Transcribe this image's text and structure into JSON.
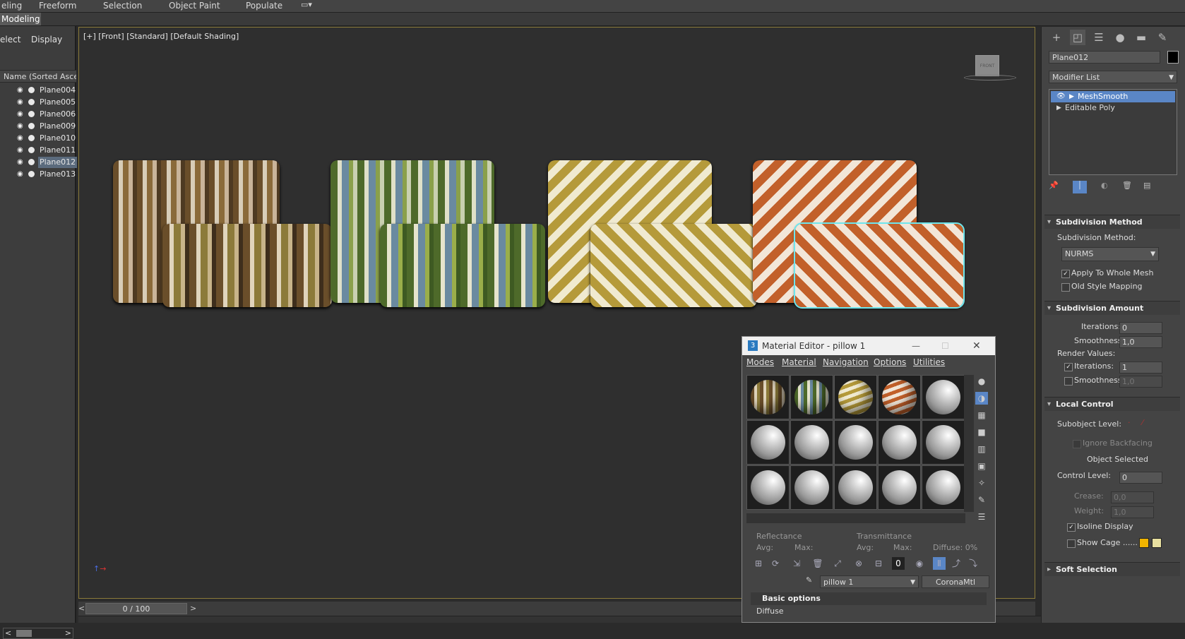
{
  "ribbon": {
    "tabs": [
      "eling",
      "Freeform",
      "Selection",
      "Object Paint",
      "Populate"
    ]
  },
  "modebar": {
    "label": "Modeling"
  },
  "explorer": {
    "tab_select": "elect",
    "tab_display": "Display",
    "column_header": "Name (Sorted Ascen",
    "items": [
      "Plane004",
      "Plane005",
      "Plane006",
      "Plane009",
      "Plane010",
      "Plane011",
      "Plane012",
      "Plane013"
    ],
    "selected": "Plane012"
  },
  "viewport": {
    "label": "[+] [Front] [Standard] [Default Shading]",
    "viewcube_label": "FRONT"
  },
  "timeline": {
    "frame": "0 / 100",
    "prev": "<",
    "next": ">"
  },
  "command_panel": {
    "object_name": "Plane012",
    "modifier_list_label": "Modifier List",
    "stack": [
      "MeshSmooth",
      "Editable Poly"
    ],
    "subdivision_method": {
      "header": "Subdivision Method",
      "label": "Subdivision Method:",
      "value": "NURMS",
      "apply_whole_mesh": "Apply To Whole Mesh",
      "old_style_mapping": "Old Style Mapping"
    },
    "subdivision_amount": {
      "header": "Subdivision Amount",
      "iterations_label": "Iterations:",
      "iterations": "0",
      "smoothness_label": "Smoothness:",
      "smoothness": "1,0",
      "render_values": "Render Values:",
      "render_iterations_label": "Iterations:",
      "render_iterations": "1",
      "render_smoothness_label": "Smoothness:",
      "render_smoothness": "1,0"
    },
    "local_control": {
      "header": "Local Control",
      "subobject_label": "Subobject Level:",
      "ignore_backfacing": "Ignore Backfacing",
      "object_selected": "Object Selected",
      "control_level_label": "Control Level:",
      "control_level": "0",
      "crease_label": "Crease:",
      "crease": "0,0",
      "weight_label": "Weight:",
      "weight": "1,0",
      "isoline_display": "Isoline Display",
      "show_cage": "Show Cage ......"
    },
    "soft_selection": {
      "header": "Soft Selection"
    }
  },
  "material_editor": {
    "title": "Material Editor - pillow 1",
    "menu": [
      "Modes",
      "Material",
      "Navigation",
      "Options",
      "Utilities"
    ],
    "reflectance_label": "Reflectance",
    "transmittance_label": "Transmittance",
    "avg_label": "Avg:",
    "max_label": "Max:",
    "diffuse_pct_label": "Diffuse: 0%",
    "material_name": "pillow 1",
    "material_type": "CoronaMtl",
    "basic_options": "Basic options",
    "diffuse_label": "Diffuse"
  },
  "colors": {
    "selection_highlight": "#5a86c6",
    "viewport_border": "#8a7a3a",
    "cage_color_1": "#f0b400",
    "cage_color_2": "#e8e0a0"
  }
}
